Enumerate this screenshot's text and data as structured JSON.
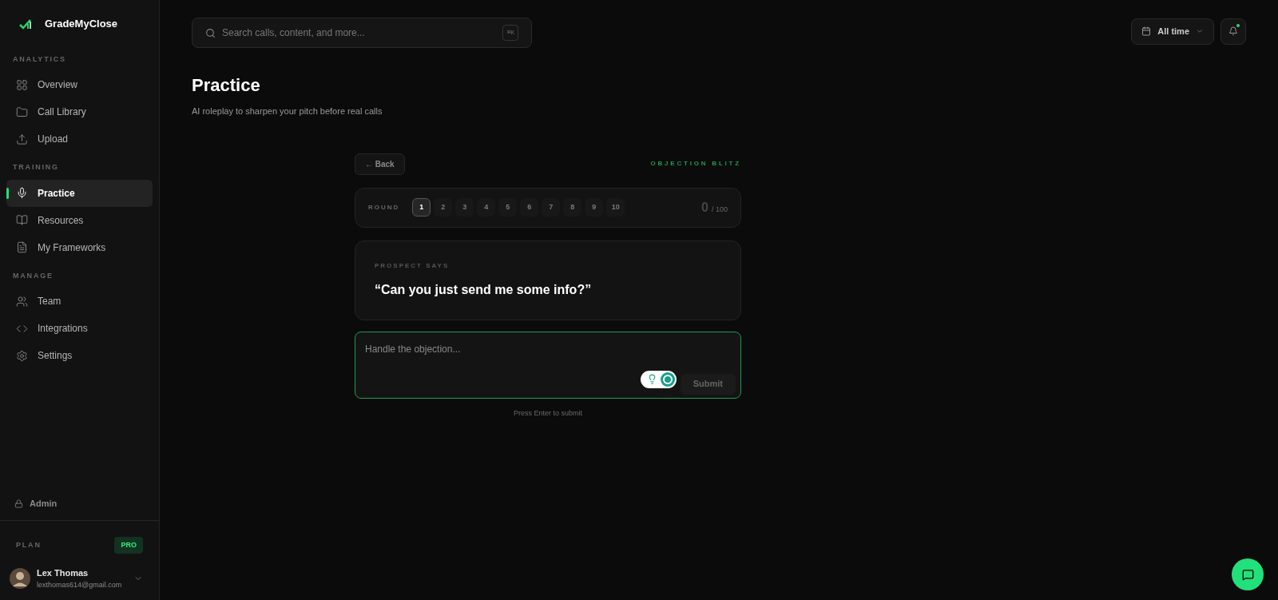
{
  "brand": {
    "name": "GradeMyClose"
  },
  "sidebar": {
    "sections": [
      {
        "title": "ANALYTICS",
        "items": [
          {
            "label": "Overview",
            "selected": false
          },
          {
            "label": "Call Library",
            "selected": false
          },
          {
            "label": "Upload",
            "selected": false
          }
        ]
      },
      {
        "title": "TRAINING",
        "items": [
          {
            "label": "Practice",
            "selected": true
          },
          {
            "label": "Resources",
            "selected": false
          },
          {
            "label": "My Frameworks",
            "selected": false
          }
        ]
      },
      {
        "title": "MANAGE",
        "items": [
          {
            "label": "Team",
            "selected": false
          },
          {
            "label": "Integrations",
            "selected": false
          },
          {
            "label": "Settings",
            "selected": false
          }
        ]
      }
    ],
    "admin": "Admin",
    "plan": {
      "label": "PLAN",
      "badge": "PRO"
    },
    "user": {
      "name": "Lex Thomas",
      "email": "lexthomas614@gmail.com"
    }
  },
  "search": {
    "placeholder": "Search calls, content, and more...",
    "shortcut": "⌘K"
  },
  "date_filter": "All time",
  "notifications": {
    "unread": true
  },
  "page": {
    "title": "Practice",
    "subtitle": "AI roleplay to sharpen your pitch before real calls"
  },
  "back_button": "← Back",
  "mode": "OBJECTION BLITZ",
  "rounds": {
    "label": "ROUND",
    "items": [
      {
        "label": "1",
        "selected": true
      },
      {
        "label": "2",
        "selected": false
      },
      {
        "label": "3",
        "selected": false
      },
      {
        "label": "4",
        "selected": false
      },
      {
        "label": "5",
        "selected": false
      },
      {
        "label": "6",
        "selected": false
      },
      {
        "label": "7",
        "selected": false
      },
      {
        "label": "8",
        "selected": false
      },
      {
        "label": "9",
        "selected": false
      },
      {
        "label": "10",
        "selected": false
      }
    ],
    "score": "0",
    "score_max": "/ 100"
  },
  "prospect": {
    "label": "PROSPECT SAYS",
    "quote": "“Can you just send me some info?”"
  },
  "answer": {
    "placeholder": "Handle the objection...",
    "submit": "Submit",
    "hint": "Press Enter to submit"
  }
}
